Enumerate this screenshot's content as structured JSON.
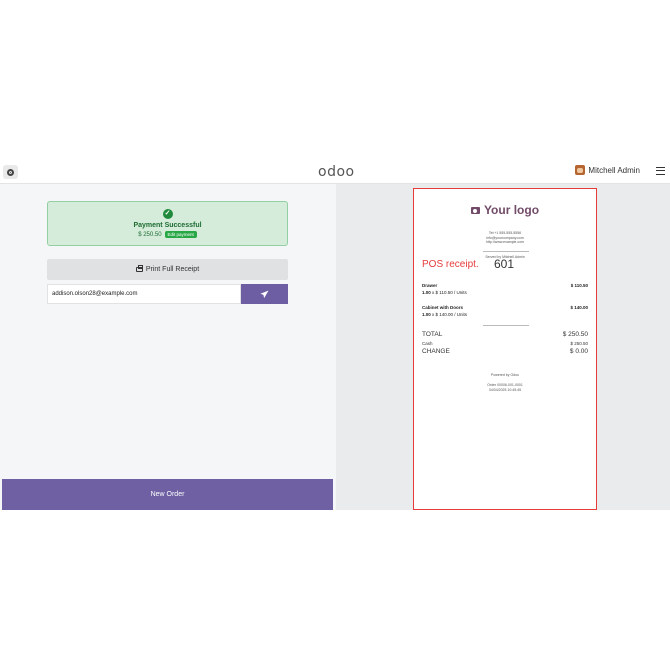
{
  "topbar": {
    "logo_text": "odoo",
    "user_name": "Mitchell Admin"
  },
  "payment": {
    "title": "Payment Successful",
    "amount": "$ 250.50",
    "edit_label": "Edit payment"
  },
  "actions": {
    "print_label": "Print Full Receipt",
    "email_value": "addison.olson28@example.com",
    "send_icon": "paper-plane-icon",
    "new_order_label": "New Order"
  },
  "receipt": {
    "logo_text": "Your logo",
    "tel": "Tel:+1 555-555-5556",
    "email": "info@yourcompany.com",
    "website": "http://www.example.com",
    "served_by": "Served by Mitchell Admin",
    "label": "POS receipt.",
    "number": "601",
    "lines": [
      {
        "name": "Drawer",
        "qty": "1.00",
        "unit": "x $ 110.50 / Units",
        "price": "$ 110.50"
      },
      {
        "name": "Cabinet with Doors",
        "qty": "1.00",
        "unit": "x $ 140.00 / Units",
        "price": "$ 140.00"
      }
    ],
    "total_label": "TOTAL",
    "total_value": "$ 250.50",
    "cash_label": "Cash",
    "cash_value": "$ 250.50",
    "change_label": "CHANGE",
    "change_value": "$ 0.00",
    "powered_by": "Powered by Odoo",
    "order_ref": "Order 00006-001-0001",
    "order_date": "04/04/2025 10:45:45"
  },
  "colors": {
    "brand": "#714b67",
    "primary_button": "#6f60a3",
    "success": "#28a745",
    "highlight_border": "#e53b3b"
  }
}
